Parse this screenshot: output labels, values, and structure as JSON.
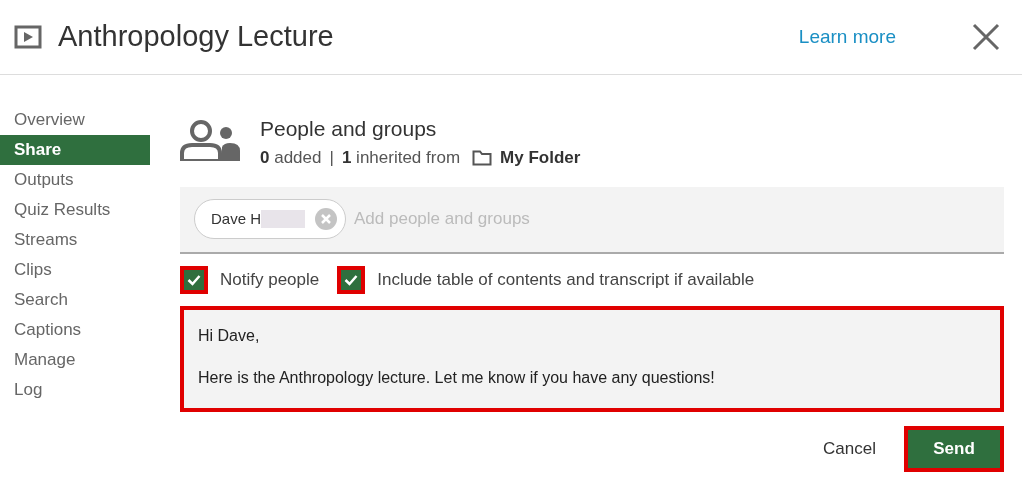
{
  "window": {
    "title": "Anthropology Lecture",
    "learn_more": "Learn more"
  },
  "sidebar": {
    "items": [
      {
        "label": "Overview",
        "selected": false
      },
      {
        "label": "Share",
        "selected": true
      },
      {
        "label": "Outputs",
        "selected": false
      },
      {
        "label": "Quiz Results",
        "selected": false
      },
      {
        "label": "Streams",
        "selected": false
      },
      {
        "label": "Clips",
        "selected": false
      },
      {
        "label": "Search",
        "selected": false
      },
      {
        "label": "Captions",
        "selected": false
      },
      {
        "label": "Manage",
        "selected": false
      },
      {
        "label": "Log",
        "selected": false
      }
    ]
  },
  "share": {
    "heading": "People and groups",
    "added_count": "0",
    "added_label": "added",
    "separator": "|",
    "inherited_count": "1",
    "inherited_label": "inherited from",
    "folder": "My Folder",
    "recipients": [
      {
        "name": "Dave H",
        "redacted": true
      }
    ],
    "placeholder": "Add people and groups",
    "options": [
      {
        "label": "Notify people",
        "checked": true,
        "highlighted": true
      },
      {
        "label": "Include table of contents and transcript if available",
        "checked": true,
        "highlighted": true
      }
    ],
    "message": {
      "lines": [
        "Hi Dave,",
        "Here is the Anthropology lecture. Let me know if you have any questions!"
      ],
      "highlighted": true
    },
    "buttons": [
      {
        "label": "Cancel",
        "kind": "secondary",
        "highlighted": false
      },
      {
        "label": "Send",
        "kind": "primary",
        "highlighted": true
      }
    ]
  }
}
